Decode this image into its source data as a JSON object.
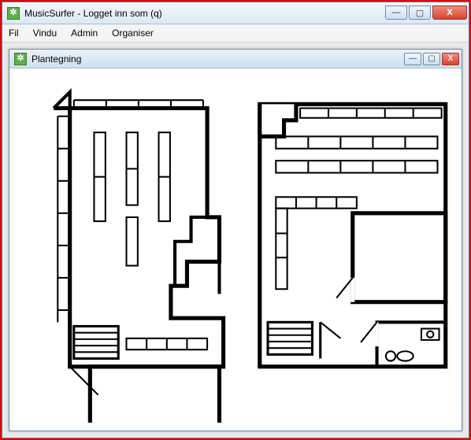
{
  "window": {
    "title": "MusicSurfer - Logget inn som (q)",
    "controls": {
      "min": "—",
      "max": "▢",
      "close": "X"
    }
  },
  "menu": {
    "items": [
      "Fil",
      "Vindu",
      "Admin",
      "Organiser"
    ]
  },
  "child_window": {
    "title": "Plantegning",
    "controls": {
      "min": "—",
      "max": "▢",
      "close": "X"
    }
  },
  "icon_glyph": "✲"
}
